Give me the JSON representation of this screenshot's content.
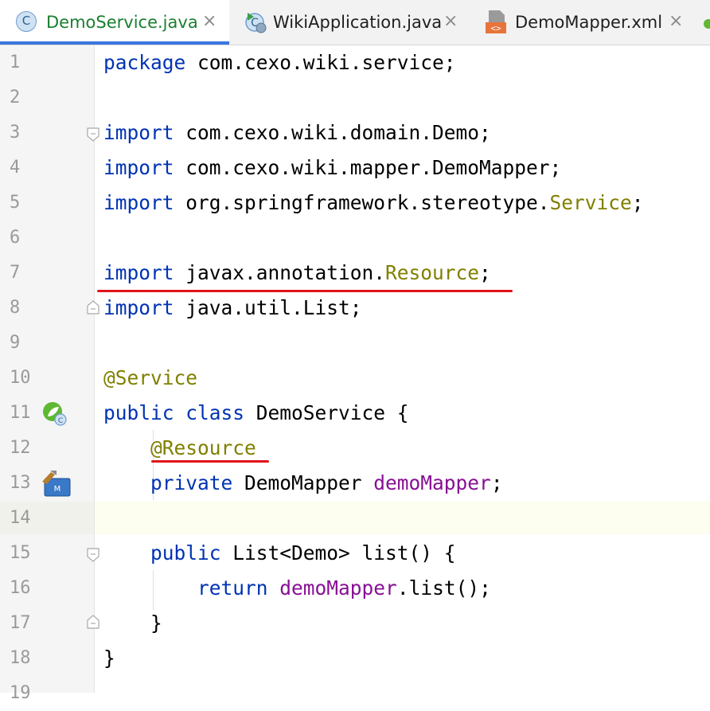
{
  "tabs": [
    {
      "label": "DemoService.java",
      "icon": "java-class-icon",
      "active": true,
      "close": "×"
    },
    {
      "label": "WikiApplication.java",
      "icon": "spring-boot-app-icon",
      "active": false,
      "close": "×"
    },
    {
      "label": "DemoMapper.xml",
      "icon": "xml-file-icon",
      "active": false,
      "close": "×"
    }
  ],
  "line_numbers": [
    "1",
    "2",
    "3",
    "4",
    "5",
    "6",
    "7",
    "8",
    "9",
    "10",
    "11",
    "12",
    "13",
    "14",
    "15",
    "16",
    "17",
    "18",
    "19"
  ],
  "code": {
    "l1": {
      "kw": "package",
      "rest": " com.cexo.wiki.service;"
    },
    "l3": {
      "kw": "import",
      "rest": " com.cexo.wiki.domain.Demo;"
    },
    "l4": {
      "kw": "import",
      "rest": " com.cexo.wiki.mapper.DemoMapper;"
    },
    "l5": {
      "kw": "import",
      "rest": " org.springframework.stereotype.",
      "ann": "Service",
      "end": ";"
    },
    "l7": {
      "kw": "import",
      "rest": " javax.annotation.",
      "ann": "Resource",
      "end": ";"
    },
    "l8": {
      "kw": "import",
      "rest": " java.util.List;"
    },
    "l10": {
      "ann": "@Service"
    },
    "l11": {
      "kw1": "public",
      "kw2": "class",
      "rest": " DemoService {"
    },
    "l12": {
      "indent": "    ",
      "ann": "@Resource"
    },
    "l13": {
      "indent": "    ",
      "kw": "private",
      "rest": " DemoMapper ",
      "fld": "demoMapper",
      "end": ";"
    },
    "l15": {
      "indent": "    ",
      "kw": "public",
      "rest": " List<Demo> list() {"
    },
    "l16": {
      "indent": "        ",
      "kw": "return",
      "sp": " ",
      "fld": "demoMapper",
      "rest": ".list();"
    },
    "l17": {
      "indent": "    ",
      "rest": "}"
    },
    "l18": {
      "rest": "}"
    }
  },
  "colors": {
    "keyword": "#0033b3",
    "annotation": "#808000",
    "field": "#871094",
    "underline": "#e0141a",
    "active_tab_text": "#1a7f2f"
  }
}
